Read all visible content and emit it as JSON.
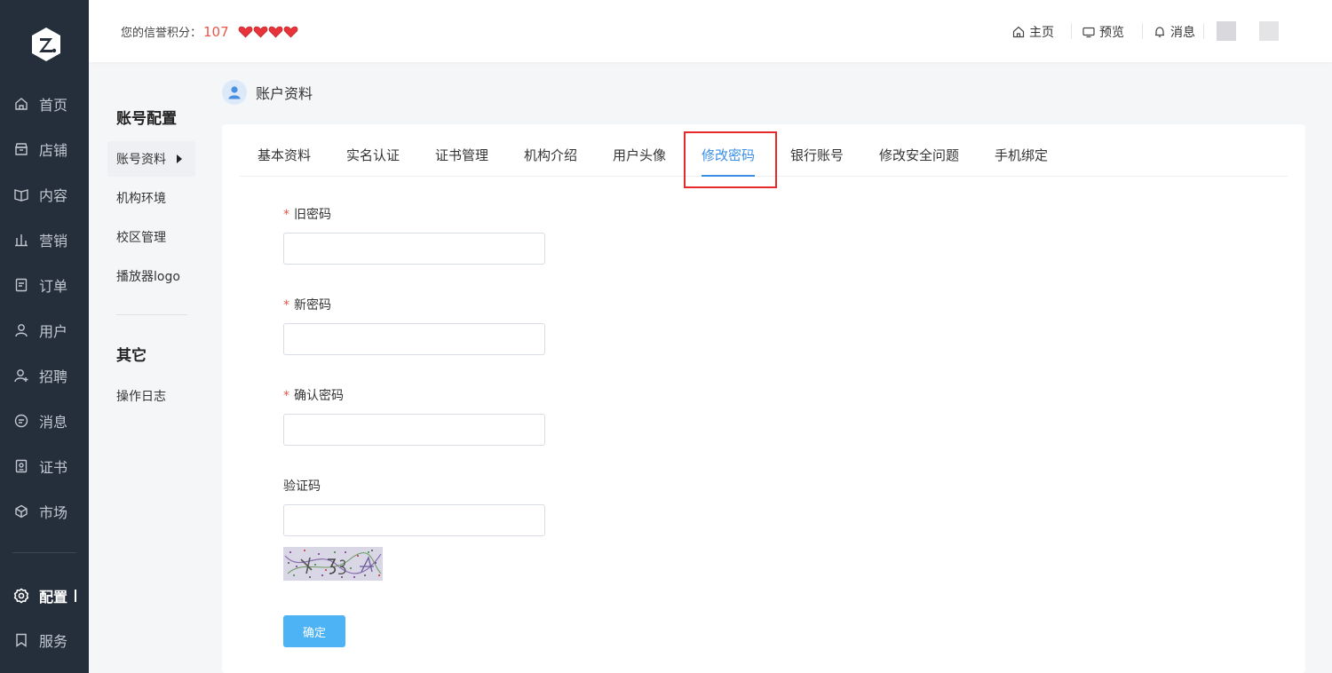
{
  "sidebar": {
    "items": [
      {
        "label": "首页",
        "icon": "home-icon"
      },
      {
        "label": "店铺",
        "icon": "store-icon"
      },
      {
        "label": "内容",
        "icon": "book-icon"
      },
      {
        "label": "营销",
        "icon": "bar-chart-icon"
      },
      {
        "label": "订单",
        "icon": "document-icon"
      },
      {
        "label": "用户",
        "icon": "user-icon"
      },
      {
        "label": "招聘",
        "icon": "user-add-icon"
      },
      {
        "label": "消息",
        "icon": "chat-icon"
      },
      {
        "label": "证书",
        "icon": "certificate-icon"
      },
      {
        "label": "市场",
        "icon": "cube-icon"
      },
      {
        "label": "配置",
        "icon": "gear-icon"
      },
      {
        "label": "服务",
        "icon": "bookmark-icon"
      }
    ],
    "active_item": "配置"
  },
  "header": {
    "credit_label": "您的信誉积分：",
    "credit_score": "107",
    "hearts": 4,
    "links": {
      "home": "主页",
      "preview": "预览",
      "messages": "消息"
    }
  },
  "submenu": {
    "group1_title": "账号配置",
    "group1_items": [
      "账号资料",
      "机构环境",
      "校区管理",
      "播放器logo"
    ],
    "group2_title": "其它",
    "group2_items": [
      "操作日志"
    ]
  },
  "page": {
    "title": "账户资料"
  },
  "tabs": [
    "基本资料",
    "实名认证",
    "证书管理",
    "机构介绍",
    "用户头像",
    "修改密码",
    "银行账号",
    "修改安全问题",
    "手机绑定"
  ],
  "active_tab": "修改密码",
  "form": {
    "old_password_label": "旧密码",
    "new_password_label": "新密码",
    "confirm_password_label": "确认密码",
    "captcha_label": "验证码",
    "required_mark": "*",
    "old_password_value": "",
    "new_password_value": "",
    "confirm_password_value": "",
    "captcha_value": "",
    "submit_label": "确定"
  },
  "colors": {
    "sidebar_bg": "#252e3b",
    "accent": "#3a8ee6",
    "button": "#4db3f5",
    "score": "#e8574b",
    "highlight": "#e62a2a"
  }
}
